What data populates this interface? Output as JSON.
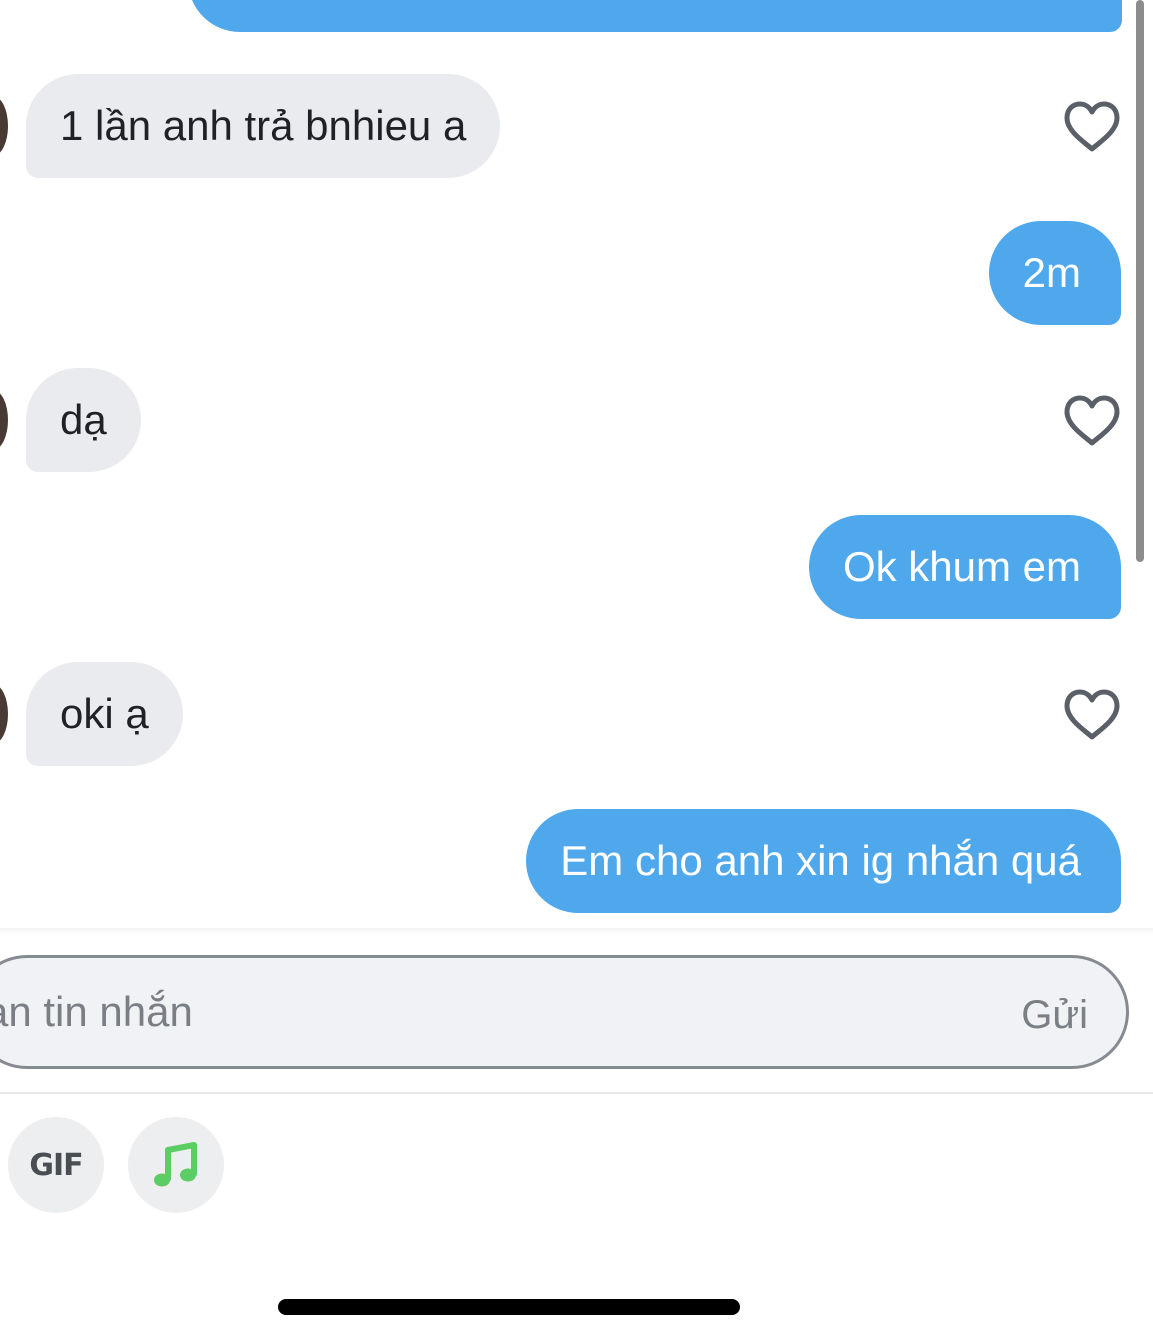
{
  "conversation": {
    "messages": [
      {
        "direction": "outgoing",
        "text": ""
      },
      {
        "direction": "incoming",
        "text": "1 lần anh trả bnhieu a"
      },
      {
        "direction": "outgoing",
        "text": "2m"
      },
      {
        "direction": "incoming",
        "text": "dạ"
      },
      {
        "direction": "outgoing",
        "text": "Ok khum em"
      },
      {
        "direction": "incoming",
        "text": "oki ạ"
      },
      {
        "direction": "outgoing",
        "text": "Em cho anh xin ig nhắn quá"
      }
    ]
  },
  "composer": {
    "placeholder": "ạn tin nhắn",
    "value": "",
    "send_label": "Gửi"
  },
  "toolbar": {
    "gif_label": "GIF",
    "music_icon": "music-note-icon"
  },
  "colors": {
    "outgoing_bubble": "#4fa7ec",
    "incoming_bubble": "#eaebef",
    "music_icon": "#5ccc64",
    "heart_outline": "#5b6068"
  }
}
